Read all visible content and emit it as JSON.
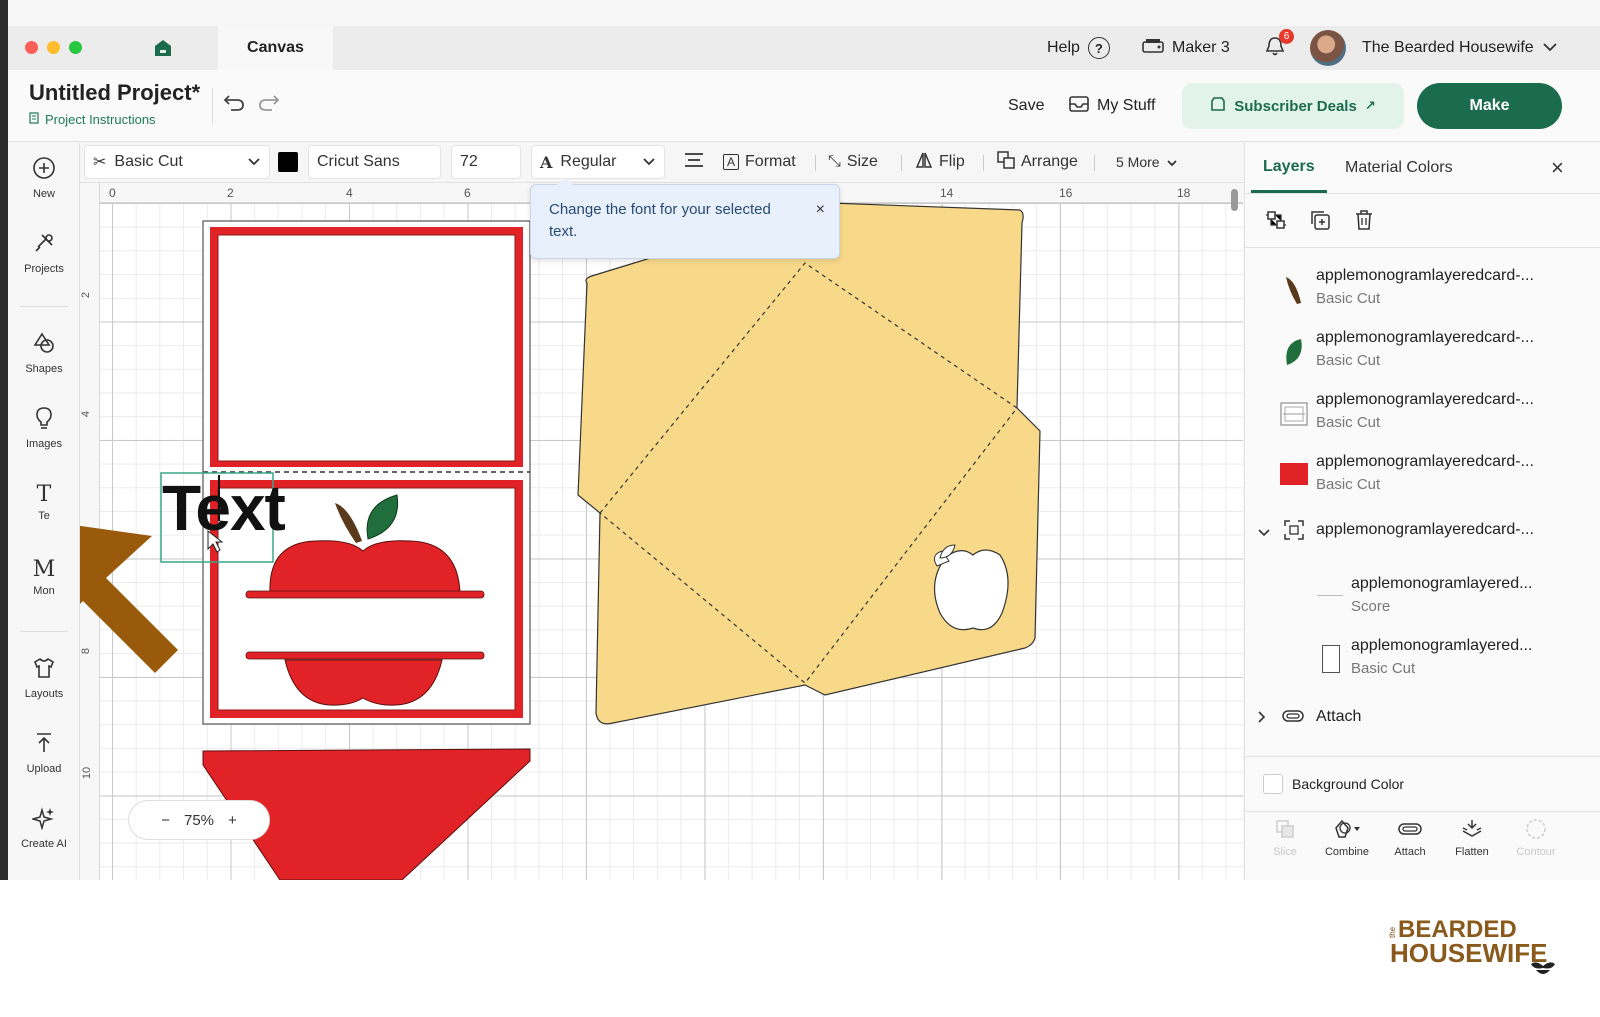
{
  "titlebar": {
    "tab": "Canvas",
    "help": "Help",
    "help_icon": "?",
    "machine": "Maker 3",
    "notifications": "6",
    "user": "The Bearded Housewife"
  },
  "header": {
    "title": "Untitled Project*",
    "instructions": "Project Instructions",
    "save": "Save",
    "my_stuff": "My Stuff",
    "subscriber_deals": "Subscriber Deals",
    "make": "Make"
  },
  "tools": [
    {
      "label": "New",
      "icon": "plus-circle-icon"
    },
    {
      "label": "Projects",
      "icon": "projects-icon"
    },
    {
      "label": "Shapes",
      "icon": "shapes-icon"
    },
    {
      "label": "Images",
      "icon": "lightbulb-icon"
    },
    {
      "label": "Text",
      "icon": "text-icon"
    },
    {
      "label": "Monogram",
      "icon": "monogram-icon"
    },
    {
      "label": "Layouts",
      "icon": "shirt-icon"
    },
    {
      "label": "Upload",
      "icon": "upload-icon"
    },
    {
      "label": "Create AI",
      "icon": "sparkle-icon"
    }
  ],
  "tools_partial": {
    "text": "Te",
    "mono": "Mon"
  },
  "editbar": {
    "operation": "Basic Cut",
    "color": "#000000",
    "font": "Cricut Sans",
    "size": "72",
    "style": "Regular",
    "format": "Format",
    "size_label": "Size",
    "flip": "Flip",
    "arrange": "Arrange",
    "more": "5 More"
  },
  "ruler": {
    "top": [
      "0",
      "2",
      "4",
      "6",
      "14",
      "16",
      "18"
    ],
    "left": [
      "2",
      "4",
      "8",
      "10"
    ]
  },
  "tooltip": {
    "text": "Change the font for your selected text.",
    "close": "×"
  },
  "canvas": {
    "text_object": "Text",
    "zoom": "75%",
    "zoom_minus": "−",
    "zoom_plus": "+",
    "colors": {
      "red": "#e12227",
      "envelope": "#f8d98a",
      "leaf": "#1f6e3b",
      "stem": "#5a3a1c",
      "arrow": "#9a5a0c"
    }
  },
  "panel": {
    "tabs": [
      "Layers",
      "Material Colors"
    ],
    "close": "×",
    "layers": [
      {
        "name": "applemonogramlayeredcard-...",
        "op": "Basic Cut",
        "thumb": "stem"
      },
      {
        "name": "applemonogramlayeredcard-...",
        "op": "Basic Cut",
        "thumb": "leaf"
      },
      {
        "name": "applemonogramlayeredcard-...",
        "op": "Basic Cut",
        "thumb": "card-outline"
      },
      {
        "name": "applemonogramlayeredcard-...",
        "op": "Basic Cut",
        "thumb": "red-rect"
      }
    ],
    "group": {
      "name": "applemonogramlayeredcard-..."
    },
    "children": [
      {
        "name": "applemonogramlayered...",
        "op": "Score"
      },
      {
        "name": "applemonogramlayered...",
        "op": "Basic Cut"
      }
    ],
    "attach_group": "Attach",
    "background_color": "Background Color",
    "actions": [
      "Slice",
      "Combine",
      "Attach",
      "Flatten",
      "Contour"
    ]
  },
  "watermark": {
    "line1": "BEARDED",
    "line2": "HOUSEWIFE",
    "small": "the"
  }
}
